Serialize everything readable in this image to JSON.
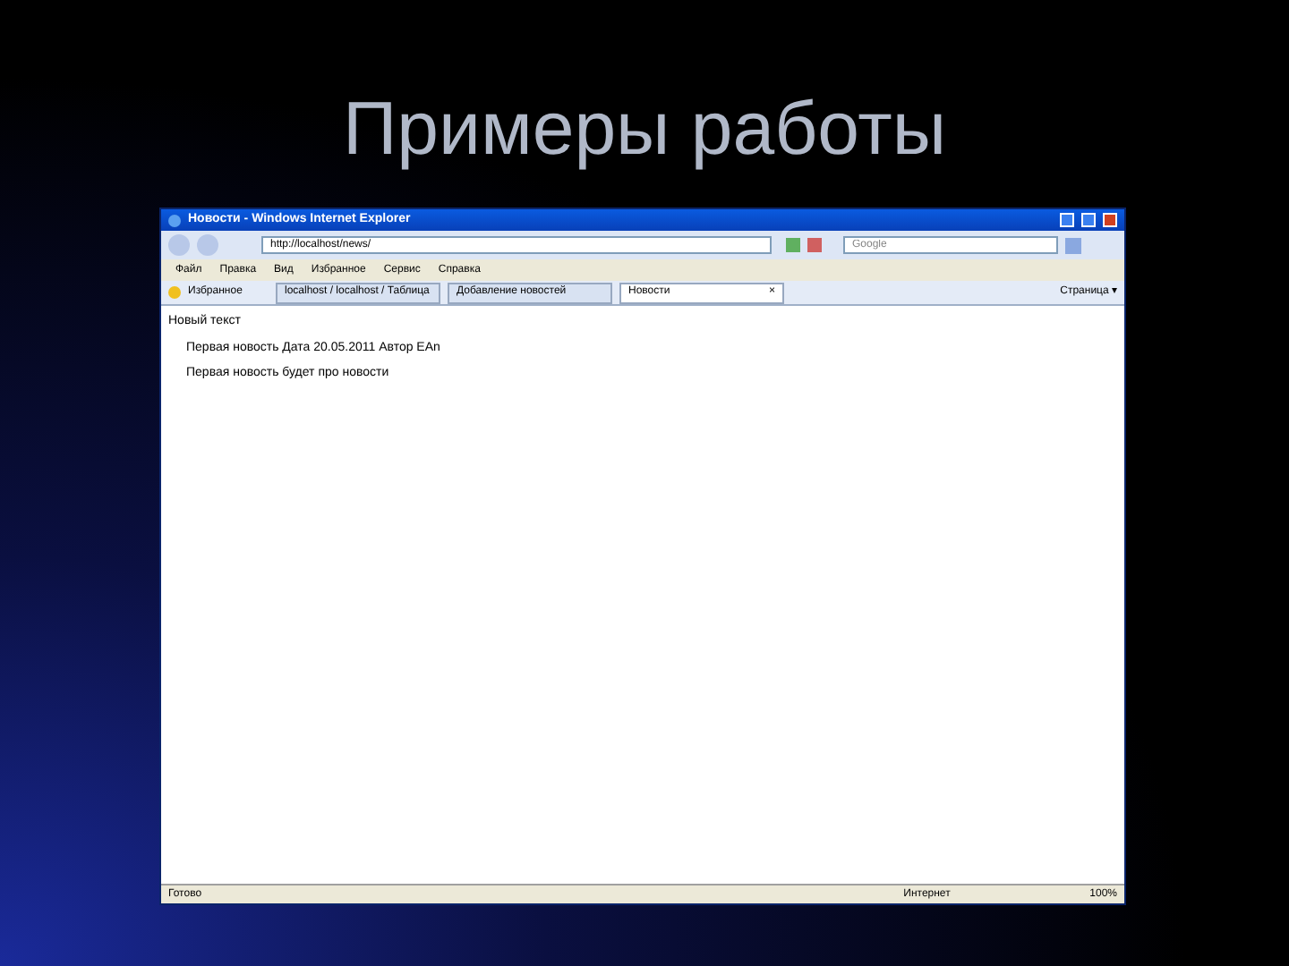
{
  "slide_title": "Примеры работы",
  "window": {
    "title": "Новости - Windows Internet Explorer"
  },
  "address": {
    "value": "http://localhost/news/"
  },
  "search": {
    "placeholder": "Google"
  },
  "menu": [
    "Файл",
    "Правка",
    "Вид",
    "Избранное",
    "Сервис",
    "Справка"
  ],
  "favorites": "Избранное",
  "tabs": [
    {
      "label": "localhost / localhost / Таблица",
      "selected": false
    },
    {
      "label": "Добавление новостей",
      "selected": false
    },
    {
      "label": "Новости",
      "selected": true
    }
  ],
  "close_tab": "×",
  "page_menu": "Страница ▾",
  "content": {
    "heading": "Новый текст",
    "lines": [
      "Первая новость Дата 20.05.2011 Автор EAn",
      "Первая новость будет про новости"
    ]
  },
  "status_bar": {
    "text": "Готово",
    "zone": "Интернет",
    "zoom": "100%"
  }
}
